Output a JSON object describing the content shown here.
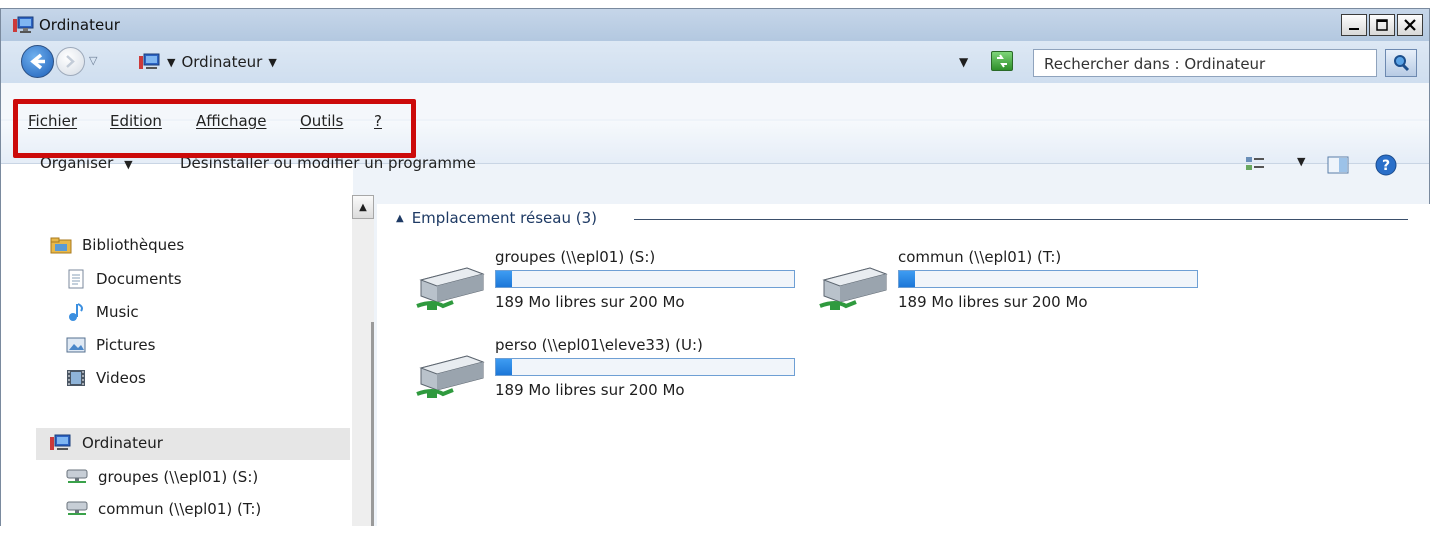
{
  "window": {
    "title": "Ordinateur"
  },
  "address": {
    "path": "Ordinateur",
    "search_placeholder": "Rechercher dans : Ordinateur"
  },
  "menu": [
    {
      "label": "Fichier"
    },
    {
      "label": "Edition"
    },
    {
      "label": "Affichage"
    },
    {
      "label": "Outils"
    },
    {
      "label": "?"
    }
  ],
  "toolbar": {
    "organize": "Organiser",
    "uninstall": "Désinstaller ou modifier un programme"
  },
  "sidebar": {
    "libraries": "Bibliothèques",
    "items": [
      {
        "label": "Documents",
        "icon": "document-icon"
      },
      {
        "label": "Music",
        "icon": "music-icon"
      },
      {
        "label": "Pictures",
        "icon": "pictures-icon"
      },
      {
        "label": "Videos",
        "icon": "videos-icon"
      }
    ],
    "computer": "Ordinateur",
    "drives": [
      {
        "label": "groupes (\\\\epl01) (S:)"
      },
      {
        "label": "commun (\\\\epl01) (T:)"
      }
    ]
  },
  "main": {
    "group_title": "Emplacement réseau (3)",
    "drives": [
      {
        "name": "groupes (\\\\epl01) (S:)",
        "free_text": "189 Mo libres sur 200 Mo",
        "used_fraction": 0.055
      },
      {
        "name": "commun (\\\\epl01) (T:)",
        "free_text": "189 Mo libres sur 200 Mo",
        "used_fraction": 0.055
      },
      {
        "name": "perso (\\\\epl01\\eleve33) (U:)",
        "free_text": "189 Mo libres sur 200 Mo",
        "used_fraction": 0.055
      }
    ]
  },
  "colors": {
    "highlight_box": "#cc0a0a",
    "bar_fill": "#2a86e6"
  }
}
